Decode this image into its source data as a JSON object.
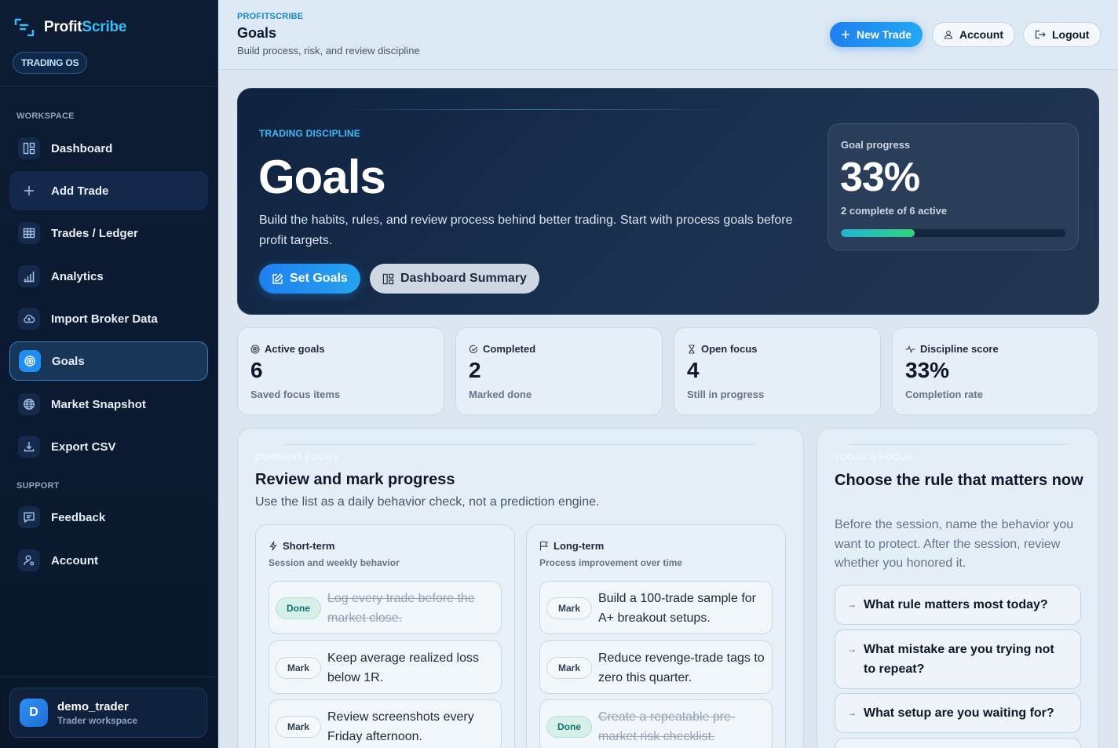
{
  "brand": {
    "name_part1": "Profit",
    "name_part2": "Scribe",
    "badge": "TRADING OS"
  },
  "sidebar": {
    "section_workspace": "WORKSPACE",
    "section_support": "SUPPORT",
    "items": [
      {
        "label": "Dashboard",
        "icon": "dashboard-icon"
      },
      {
        "label": "Add Trade",
        "icon": "plus-icon"
      },
      {
        "label": "Trades / Ledger",
        "icon": "table-icon"
      },
      {
        "label": "Analytics",
        "icon": "bar-chart-icon"
      },
      {
        "label": "Import Broker Data",
        "icon": "cloud-upload-icon"
      },
      {
        "label": "Goals",
        "icon": "target-icon"
      },
      {
        "label": "Market Snapshot",
        "icon": "globe-icon"
      },
      {
        "label": "Export CSV",
        "icon": "download-icon"
      }
    ],
    "support_items": [
      {
        "label": "Feedback",
        "icon": "message-icon"
      },
      {
        "label": "Account",
        "icon": "user-settings-icon"
      }
    ],
    "user": {
      "initial": "D",
      "name": "demo_trader",
      "sub": "Trader workspace"
    }
  },
  "topbar": {
    "crumb": "PROFITSCRIBE",
    "title": "Goals",
    "subtitle": "Build process, risk, and review discipline",
    "new_trade": "New Trade",
    "account": "Account",
    "logout": "Logout"
  },
  "hero": {
    "kicker": "TRADING DISCIPLINE",
    "title": "Goals",
    "description": "Build the habits, rules, and review process behind better trading. Start with process goals before profit targets.",
    "set_goals": "Set Goals",
    "dashboard_summary": "Dashboard Summary",
    "progress": {
      "label": "Goal progress",
      "value": "33%",
      "sub": "2 complete of 6 active",
      "fraction": 0.33
    }
  },
  "stats": [
    {
      "label": "Active goals",
      "value": "6",
      "sub": "Saved focus items",
      "icon": "target-icon"
    },
    {
      "label": "Completed",
      "value": "2",
      "sub": "Marked done",
      "icon": "check-circle-icon"
    },
    {
      "label": "Open focus",
      "value": "4",
      "sub": "Still in progress",
      "icon": "hourglass-icon"
    },
    {
      "label": "Discipline score",
      "value": "33%",
      "sub": "Completion rate",
      "icon": "activity-icon"
    }
  ],
  "review": {
    "kicker": "CURRENT FOCUS",
    "title": "Review and mark progress",
    "description": "Use the list as a daily behavior check, not a prediction engine.",
    "short_term": {
      "title": "Short-term",
      "sub": "Session and weekly behavior",
      "goals": [
        {
          "chip": "Done",
          "text": "Log every trade before the market close.",
          "done": true
        },
        {
          "chip": "Mark",
          "text": "Keep average realized loss below 1R.",
          "done": false
        },
        {
          "chip": "Mark",
          "text": "Review screenshots every Friday afternoon.",
          "done": false
        }
      ]
    },
    "long_term": {
      "title": "Long-term",
      "sub": "Process improvement over time",
      "goals": [
        {
          "chip": "Mark",
          "text": "Build a 100-trade sample for A+ breakout setups.",
          "done": false
        },
        {
          "chip": "Mark",
          "text": "Reduce revenge-trade tags to zero this quarter.",
          "done": false
        },
        {
          "chip": "Done",
          "text": "Create a repeatable pre-market risk checklist.",
          "done": true
        }
      ]
    }
  },
  "today": {
    "kicker": "TODAY'S FOCUS",
    "title": "Choose the rule that matters now",
    "description": "Before the session, name the behavior you want to protect. After the session, review whether you honored it.",
    "prompts": [
      "What rule matters most today?",
      "What mistake are you trying not to repeat?",
      "What setup are you waiting for?"
    ]
  },
  "colors": {
    "accent": "#1f8ef0",
    "accent_light": "#38bdf8",
    "sidebar_bg": "#0d1b33",
    "done_green": "#0f766e"
  }
}
